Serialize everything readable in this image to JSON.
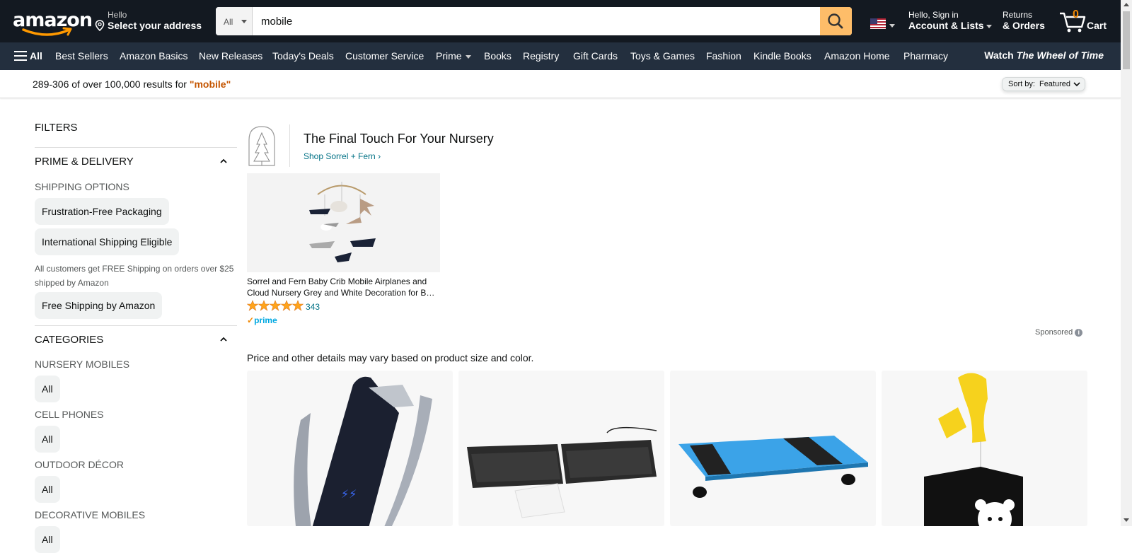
{
  "header": {
    "logo_text": "amazon",
    "address_line1": "Hello",
    "address_line2": "Select your address",
    "search": {
      "category": "All",
      "value": "mobile",
      "placeholder": "Search Amazon"
    },
    "account_line1": "Hello, Sign in",
    "account_line2": "Account & Lists",
    "orders_line1": "Returns",
    "orders_line2": "& Orders",
    "cart_count": "0",
    "cart_label": "Cart",
    "accent_color": "#febd69",
    "bg_color": "#131921"
  },
  "nav": {
    "all_label": "All",
    "items": [
      "Best Sellers",
      "Amazon Basics",
      "New Releases",
      "Today's Deals",
      "Customer Service",
      "Prime",
      "Books",
      "Registry",
      "Gift Cards",
      "Toys & Games",
      "Fashion",
      "Kindle Books",
      "Amazon Home",
      "Pharmacy"
    ],
    "promo_prefix": "Watch ",
    "promo_title": "The Wheel of Time",
    "bg_color": "#232f3e"
  },
  "results": {
    "summary": "289-306 of over 100,000 results for ",
    "query": "\"mobile\"",
    "sort_label": "Sort by:",
    "sort_value": "Featured"
  },
  "sidebar": {
    "filters_title": "FILTERS",
    "prime_title": "PRIME & DELIVERY",
    "shipping_title": "SHIPPING OPTIONS",
    "shipping_options": [
      "Frustration-Free Packaging",
      "International Shipping Eligible"
    ],
    "shipping_note": "All customers get FREE Shipping on orders over $25 shipped by Amazon",
    "free_shipping": "Free Shipping by Amazon",
    "categories_title": "CATEGORIES",
    "categories": [
      {
        "title": "NURSERY MOBILES",
        "chip": "All"
      },
      {
        "title": "CELL PHONES",
        "chip": "All"
      },
      {
        "title": "OUTDOOR DÉCOR",
        "chip": "All"
      },
      {
        "title": "DECORATIVE MOBILES",
        "chip": "All"
      }
    ]
  },
  "sponsored": {
    "brand_title": "The Final Touch For Your Nursery",
    "brand_link": "Shop Sorrel + Fern",
    "product_title": "Sorrel and Fern Baby Crib Mobile Airplanes and Cloud Nursery Grey and White Decoration for B…",
    "rating": 5,
    "rating_count": "343",
    "prime_label": "prime",
    "sponsored_label": "Sponsored"
  },
  "main": {
    "price_note": "Price and other details may vary based on product size and color."
  }
}
